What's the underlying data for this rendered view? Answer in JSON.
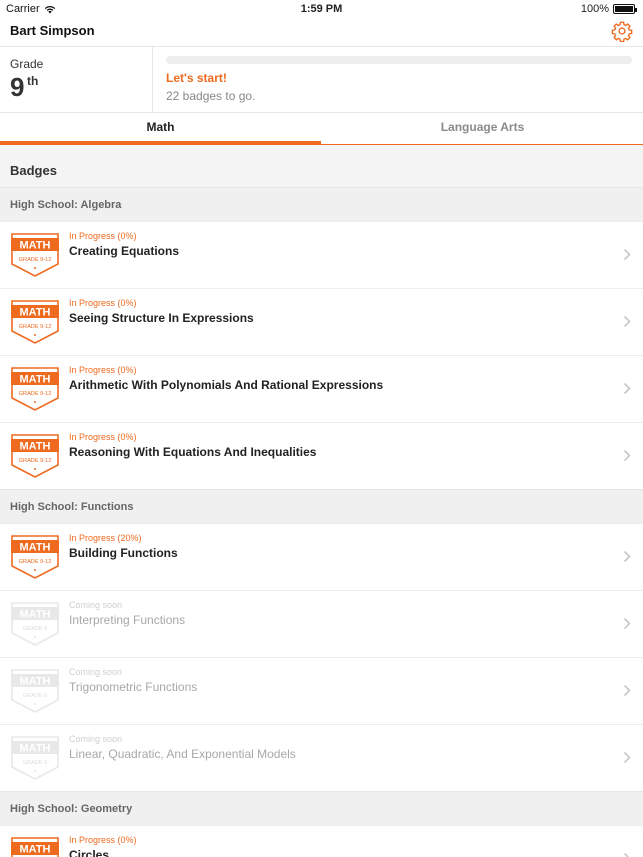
{
  "status_bar": {
    "carrier": "Carrier",
    "time": "1:59 PM",
    "battery": "100%",
    "battery_level": 1.0
  },
  "header": {
    "student_name": "Bart Simpson"
  },
  "summary": {
    "grade_label": "Grade",
    "grade_value": "9",
    "grade_suffix": "th",
    "progress_fraction": 0.0,
    "start_text": "Let's start!",
    "badges_to_go": "22 badges to go."
  },
  "tabs": [
    {
      "label": "Math",
      "active": true
    },
    {
      "label": "Language Arts",
      "active": false
    }
  ],
  "badges_title": "Badges",
  "badge_icon": {
    "top_text": "MATH",
    "grade_text": "GRADE 9-12",
    "grade_text_dim": "GRADE 9",
    "accent": "#ee6a1f",
    "dim": "#e8e8e8"
  },
  "sections": [
    {
      "title": "High School: Algebra",
      "items": [
        {
          "status": "In Progress (0%)",
          "title": "Creating Equations",
          "state": "active"
        },
        {
          "status": "In Progress (0%)",
          "title": "Seeing Structure In Expressions",
          "state": "active"
        },
        {
          "status": "In Progress (0%)",
          "title": "Arithmetic With Polynomials And Rational Expressions",
          "state": "active"
        },
        {
          "status": "In Progress (0%)",
          "title": "Reasoning With Equations And Inequalities",
          "state": "active"
        }
      ]
    },
    {
      "title": "High School: Functions",
      "items": [
        {
          "status": "In Progress (20%)",
          "title": "Building Functions",
          "state": "active"
        },
        {
          "status": "Coming soon",
          "title": "Interpreting Functions",
          "state": "dim"
        },
        {
          "status": "Coming soon",
          "title": "Trigonometric Functions",
          "state": "dim"
        },
        {
          "status": "Coming soon",
          "title": "Linear, Quadratic, And Exponential Models",
          "state": "dim"
        }
      ]
    },
    {
      "title": "High School: Geometry",
      "items": [
        {
          "status": "In Progress (0%)",
          "title": "Circles",
          "state": "active"
        }
      ]
    }
  ],
  "colors": {
    "accent": "#ee6a1f",
    "section_bg": "#f0f0f0"
  }
}
